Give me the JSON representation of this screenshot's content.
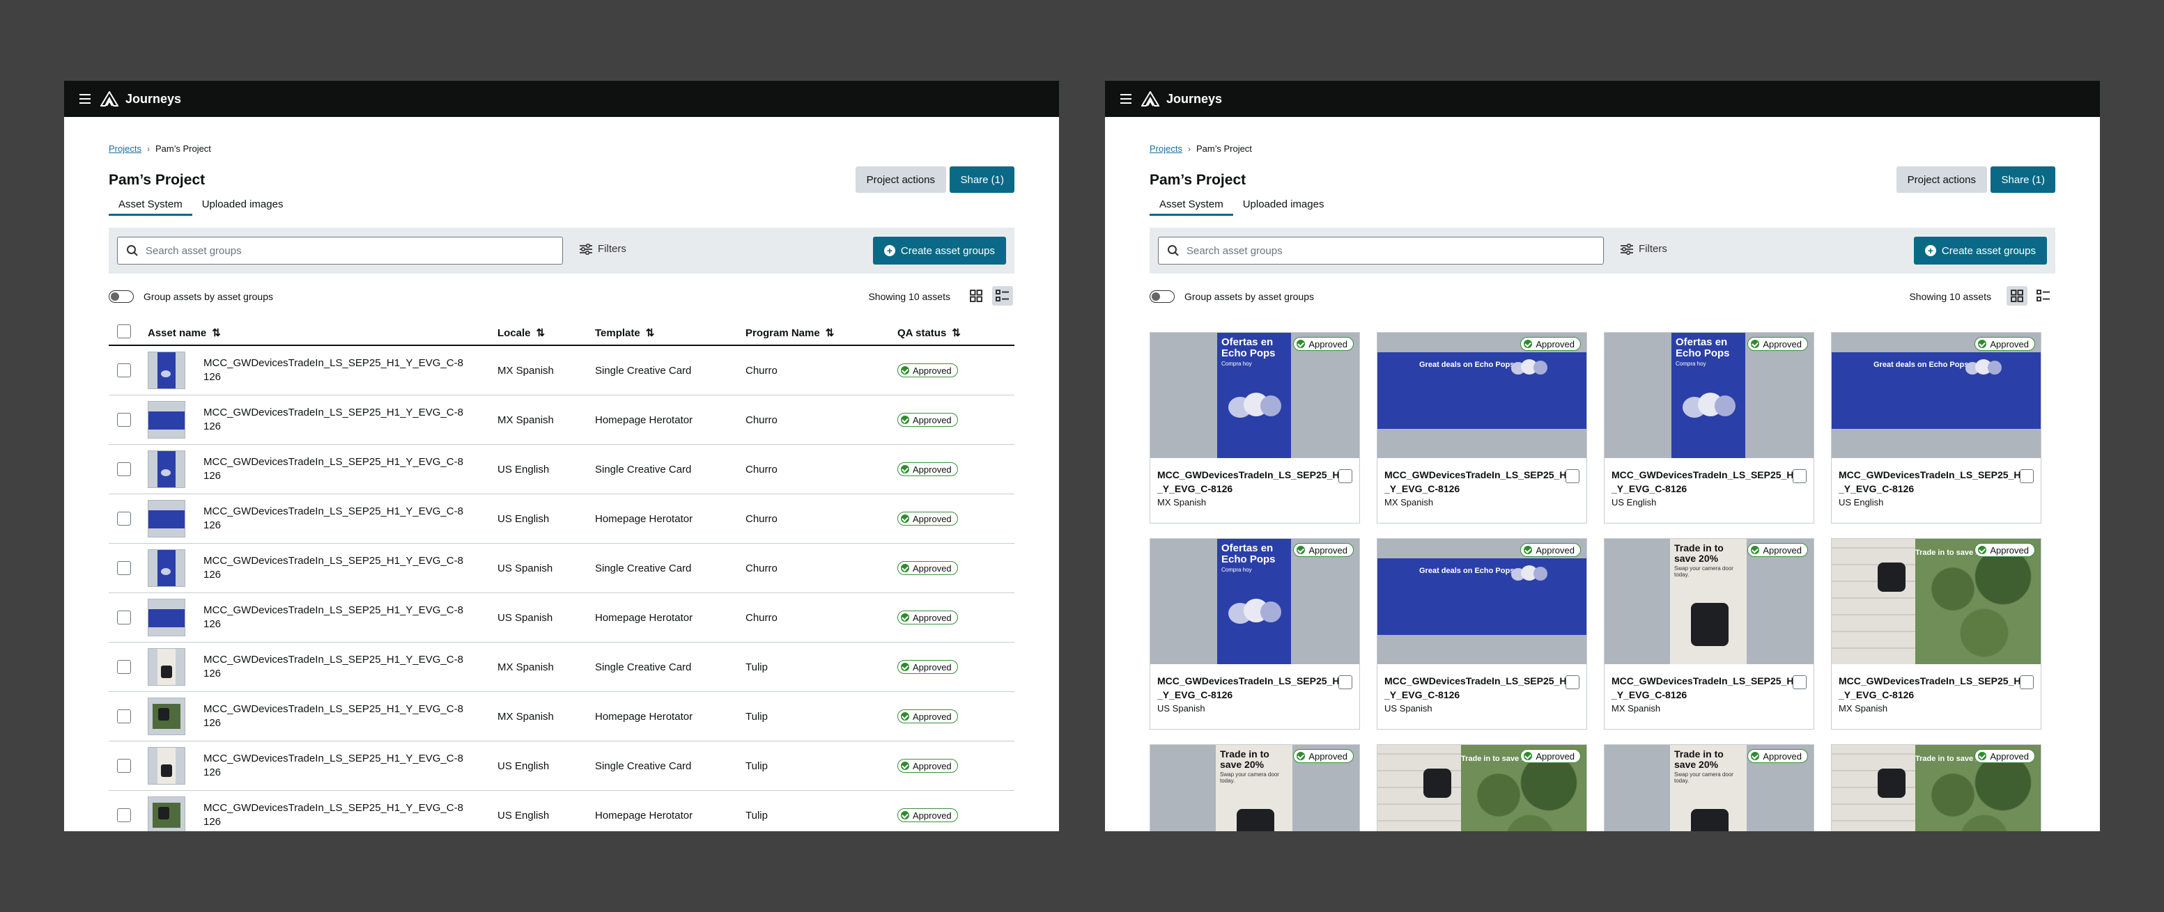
{
  "app": {
    "title": "Journeys"
  },
  "breadcrumb": {
    "root": "Projects",
    "current": "Pam’s Project"
  },
  "page": {
    "title": "Pam’s Project"
  },
  "actions": {
    "project_actions": "Project actions",
    "share": "Share (1)"
  },
  "tabs": [
    {
      "label": "Asset System",
      "active": true
    },
    {
      "label": "Uploaded images",
      "active": false
    }
  ],
  "toolbar": {
    "search_placeholder": "Search asset groups",
    "filters": "Filters",
    "create": "Create asset groups"
  },
  "options": {
    "group_toggle": "Group assets by asset groups",
    "showing": "Showing 10 assets"
  },
  "table": {
    "headers": {
      "name": "Asset name",
      "locale": "Locale",
      "template": "Template",
      "program": "Program Name",
      "qa": "QA status"
    },
    "rows": [
      {
        "name": "MCC_GWDevicesTradeIn_LS_SEP25_H1_Y_EVG_C-8\n126",
        "locale": "MX Spanish",
        "template": "Single Creative Card",
        "program": "Churro",
        "qa": "Approved"
      },
      {
        "name": "MCC_GWDevicesTradeIn_LS_SEP25_H1_Y_EVG_C-8\n126",
        "locale": "MX Spanish",
        "template": "Homepage Herotator",
        "program": "Churro",
        "qa": "Approved"
      },
      {
        "name": "MCC_GWDevicesTradeIn_LS_SEP25_H1_Y_EVG_C-8\n126",
        "locale": "US English",
        "template": "Single Creative Card",
        "program": "Churro",
        "qa": "Approved"
      },
      {
        "name": "MCC_GWDevicesTradeIn_LS_SEP25_H1_Y_EVG_C-8\n126",
        "locale": "US English",
        "template": "Homepage Herotator",
        "program": "Churro",
        "qa": "Approved"
      },
      {
        "name": "MCC_GWDevicesTradeIn_LS_SEP25_H1_Y_EVG_C-8\n126",
        "locale": "US Spanish",
        "template": "Single Creative Card",
        "program": "Churro",
        "qa": "Approved"
      },
      {
        "name": "MCC_GWDevicesTradeIn_LS_SEP25_H1_Y_EVG_C-8\n126",
        "locale": "US Spanish",
        "template": "Homepage Herotator",
        "program": "Churro",
        "qa": "Approved"
      },
      {
        "name": "MCC_GWDevicesTradeIn_LS_SEP25_H1_Y_EVG_C-8\n126",
        "locale": "MX Spanish",
        "template": "Single Creative Card",
        "program": "Tulip",
        "qa": "Approved"
      },
      {
        "name": "MCC_GWDevicesTradeIn_LS_SEP25_H1_Y_EVG_C-8\n126",
        "locale": "MX Spanish",
        "template": "Homepage Herotator",
        "program": "Tulip",
        "qa": "Approved"
      },
      {
        "name": "MCC_GWDevicesTradeIn_LS_SEP25_H1_Y_EVG_C-8\n126",
        "locale": "US English",
        "template": "Single Creative Card",
        "program": "Tulip",
        "qa": "Approved"
      },
      {
        "name": "MCC_GWDevicesTradeIn_LS_SEP25_H1_Y_EVG_C-8\n126",
        "locale": "US English",
        "template": "Homepage Herotator",
        "program": "Tulip",
        "qa": "Approved"
      }
    ]
  },
  "cards": [
    {
      "name": "MCC_GWDevicesTradeIn_LS_SEP25_H1\n_Y_EVG_C-8126",
      "locale": "MX Spanish",
      "qa": "Approved",
      "creative": "portrait-pops",
      "headline": "Ofertas en Echo Pops",
      "sub": "Compra hoy"
    },
    {
      "name": "MCC_GWDevicesTradeIn_LS_SEP25_H1\n_Y_EVG_C-8126",
      "locale": "MX Spanish",
      "qa": "Approved",
      "creative": "wide-pops",
      "headline": "Great deals on Echo Pops",
      "sub": ""
    },
    {
      "name": "MCC_GWDevicesTradeIn_LS_SEP25_H1\n_Y_EVG_C-8126",
      "locale": "US English",
      "qa": "Approved",
      "creative": "portrait-pops",
      "headline": "Ofertas en Echo Pops",
      "sub": "Compra hoy"
    },
    {
      "name": "MCC_GWDevicesTradeIn_LS_SEP25_H1\n_Y_EVG_C-8126",
      "locale": "US English",
      "qa": "Approved",
      "creative": "wide-pops",
      "headline": "Great deals on Echo Pops",
      "sub": ""
    },
    {
      "name": "MCC_GWDevicesTradeIn_LS_SEP25_H1\n_Y_EVG_C-8126",
      "locale": "US Spanish",
      "qa": "Approved",
      "creative": "portrait-pops",
      "headline": "Ofertas en Echo Pops",
      "sub": "Compra hoy"
    },
    {
      "name": "MCC_GWDevicesTradeIn_LS_SEP25_H1\n_Y_EVG_C-8126",
      "locale": "US Spanish",
      "qa": "Approved",
      "creative": "wide-pops",
      "headline": "Great deals on Echo Pops",
      "sub": ""
    },
    {
      "name": "MCC_GWDevicesTradeIn_LS_SEP25_H1\n_Y_EVG_C-8126",
      "locale": "MX Spanish",
      "qa": "Approved",
      "creative": "portrait-cam",
      "headline": "Trade in to save 20%",
      "sub": "Swap your camera door today."
    },
    {
      "name": "MCC_GWDevicesTradeIn_LS_SEP25_H1\n_Y_EVG_C-8126",
      "locale": "MX Spanish",
      "qa": "Approved",
      "creative": "wide-cam",
      "headline": "Trade in to save 20%",
      "sub": ""
    },
    {
      "name": "",
      "locale": "",
      "qa": "Approved",
      "creative": "portrait-cam",
      "headline": "Trade in to save 20%",
      "sub": "Swap your camera door today."
    },
    {
      "name": "",
      "locale": "",
      "qa": "Approved",
      "creative": "wide-cam",
      "headline": "Trade in to save 20%",
      "sub": ""
    },
    {
      "name": "",
      "locale": "",
      "qa": "Approved",
      "creative": "portrait-cam",
      "headline": "Trade in to save 20%",
      "sub": "Swap your camera door today."
    },
    {
      "name": "",
      "locale": "",
      "qa": "Approved",
      "creative": "wide-cam",
      "headline": "Trade in to save 20%",
      "sub": ""
    }
  ],
  "colors": {
    "nav_bg": "#0f1111",
    "primary": "#0a6987",
    "approved": "#2e8b2e",
    "creative_blue": "#2b3fa8"
  },
  "icons": [
    "menu-icon",
    "journeys-logo-icon",
    "chevron-right-icon",
    "search-icon",
    "filters-icon",
    "plus-circle-icon",
    "grid-view-icon",
    "list-view-icon",
    "sort-icon",
    "check-circle-icon"
  ]
}
